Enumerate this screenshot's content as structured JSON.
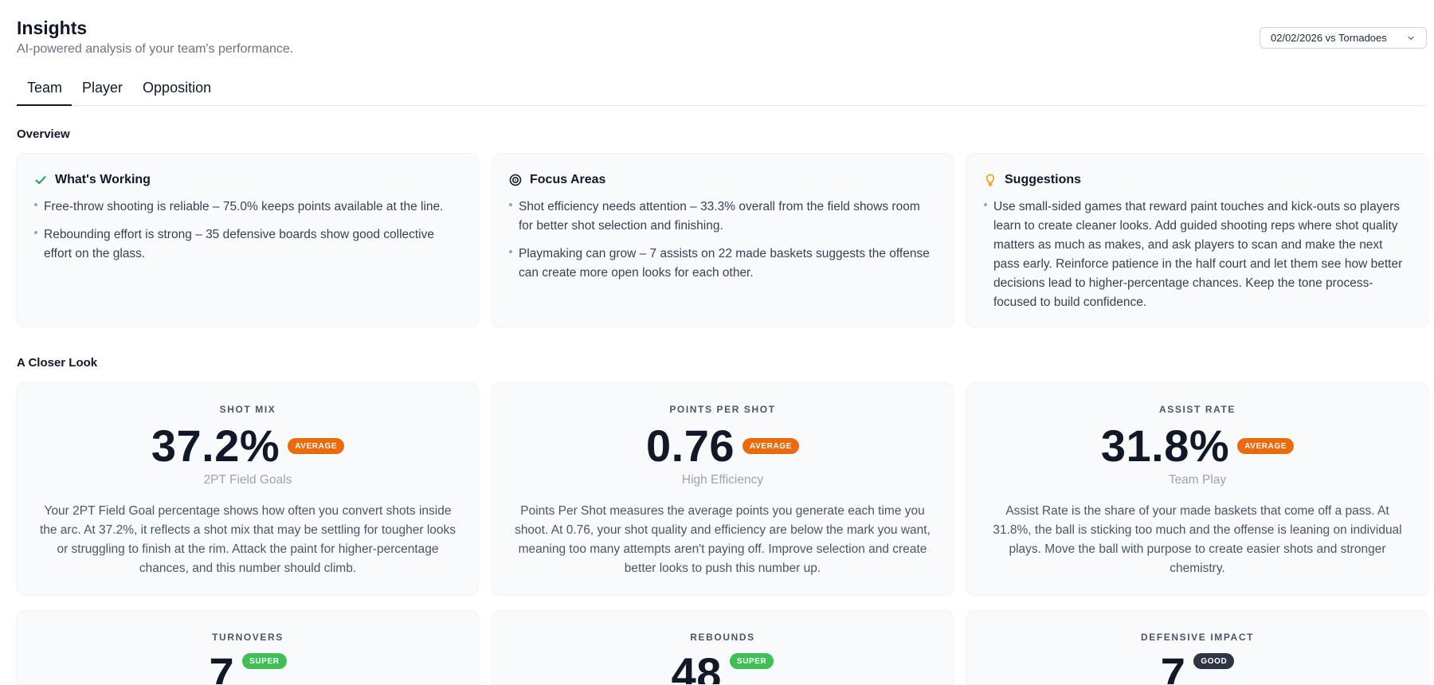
{
  "header": {
    "title": "Insights",
    "subtitle": "AI-powered analysis of your team's performance."
  },
  "game_selector": {
    "value": "02/02/2026 vs Tornadoes",
    "icon": "chevron-down-icon"
  },
  "tabs": [
    {
      "label": "Team",
      "active": true
    },
    {
      "label": "Player",
      "active": false
    },
    {
      "label": "Opposition",
      "active": false
    }
  ],
  "overview": {
    "title": "Overview",
    "cards": [
      {
        "title": "What's Working",
        "icon": "check-icon",
        "icon_color": "#16a34a",
        "items": [
          "Free-throw shooting is reliable – 75.0% keeps points available at the line.",
          "Rebounding effort is strong – 35 defensive boards show good collective effort on the glass."
        ]
      },
      {
        "title": "Focus Areas",
        "icon": "target-icon",
        "icon_color": "#111827",
        "items": [
          "Shot efficiency needs attention – 33.3% overall from the field shows room for better shot selection and finishing.",
          "Playmaking can grow – 7 assists on 22 made baskets suggests the offense can create more open looks for each other."
        ]
      },
      {
        "title": "Suggestions",
        "icon": "lightbulb-icon",
        "icon_color": "#f59e0b",
        "items": [
          "Use small-sided games that reward paint touches and kick-outs so players learn to create cleaner looks. Add guided shooting reps where shot quality matters as much as makes, and ask players to scan and make the next pass early. Reinforce patience in the half court and let them see how better decisions lead to higher-percentage chances. Keep the tone process-focused to build confidence."
        ]
      }
    ]
  },
  "closer_look": {
    "title": "A Closer Look",
    "metrics": [
      {
        "label": "SHOT MIX",
        "value": "37.2%",
        "badge": "AVERAGE",
        "badge_color": "#ea6a0c",
        "sub": "2PT Field Goals",
        "desc": "Your 2PT Field Goal percentage shows how often you convert shots inside the arc. At 37.2%, it reflects a shot mix that may be settling for tougher looks or struggling to finish at the rim. Attack the paint for higher-percentage chances, and this number should climb."
      },
      {
        "label": "POINTS PER SHOT",
        "value": "0.76",
        "badge": "AVERAGE",
        "badge_color": "#ea6a0c",
        "sub": "High Efficiency",
        "desc": "Points Per Shot measures the average points you generate each time you shoot. At 0.76, your shot quality and efficiency are below the mark you want, meaning too many attempts aren't paying off. Improve selection and create better looks to push this number up."
      },
      {
        "label": "ASSIST RATE",
        "value": "31.8%",
        "badge": "AVERAGE",
        "badge_color": "#ea6a0c",
        "sub": "Team Play",
        "desc": "Assist Rate is the share of your made baskets that come off a pass. At 31.8%, the ball is sticking too much and the offense is leaning on individual plays. Move the ball with purpose to create easier shots and stronger chemistry."
      },
      {
        "label": "TURNOVERS",
        "value": "7",
        "badge": "SUPER",
        "badge_color": "#3fbf55",
        "sub": "",
        "desc": ""
      },
      {
        "label": "REBOUNDS",
        "value": "48",
        "badge": "SUPER",
        "badge_color": "#3fbf55",
        "sub": "",
        "desc": ""
      },
      {
        "label": "DEFENSIVE IMPACT",
        "value": "7",
        "badge": "GOOD",
        "badge_color": "#2f3542",
        "sub": "",
        "desc": ""
      }
    ]
  }
}
